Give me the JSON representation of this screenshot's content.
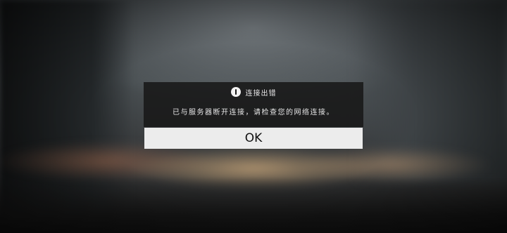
{
  "dialog": {
    "icon": "alert-circle-icon",
    "title": "连接出错",
    "message": "已与服务器断开连接，请检查您的网络连接。",
    "ok_label": "OK"
  },
  "colors": {
    "dialog_background": "#181818",
    "button_background": "#ececec",
    "text_light": "#e8e8e8",
    "text_dark": "#111111"
  }
}
